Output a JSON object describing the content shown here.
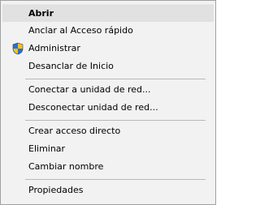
{
  "context_menu": {
    "items": [
      {
        "label": "Abrir"
      },
      {
        "label": "Anclar al Acceso rápido"
      },
      {
        "label": "Administrar",
        "icon": "uac-shield-icon"
      },
      {
        "label": "Desanclar de Inicio"
      },
      {
        "label": "Conectar a unidad de red..."
      },
      {
        "label": "Desconectar unidad de red..."
      },
      {
        "label": "Crear acceso directo"
      },
      {
        "label": "Eliminar"
      },
      {
        "label": "Cambiar nombre"
      },
      {
        "label": "Propiedades"
      }
    ],
    "colors": {
      "background": "#f2f2f2",
      "border": "#a0a0a0",
      "hover": "#e1e1e1",
      "separator": "#b9b9b9",
      "shield_blue": "#2f6fd1",
      "shield_yellow": "#f4c21b"
    }
  }
}
